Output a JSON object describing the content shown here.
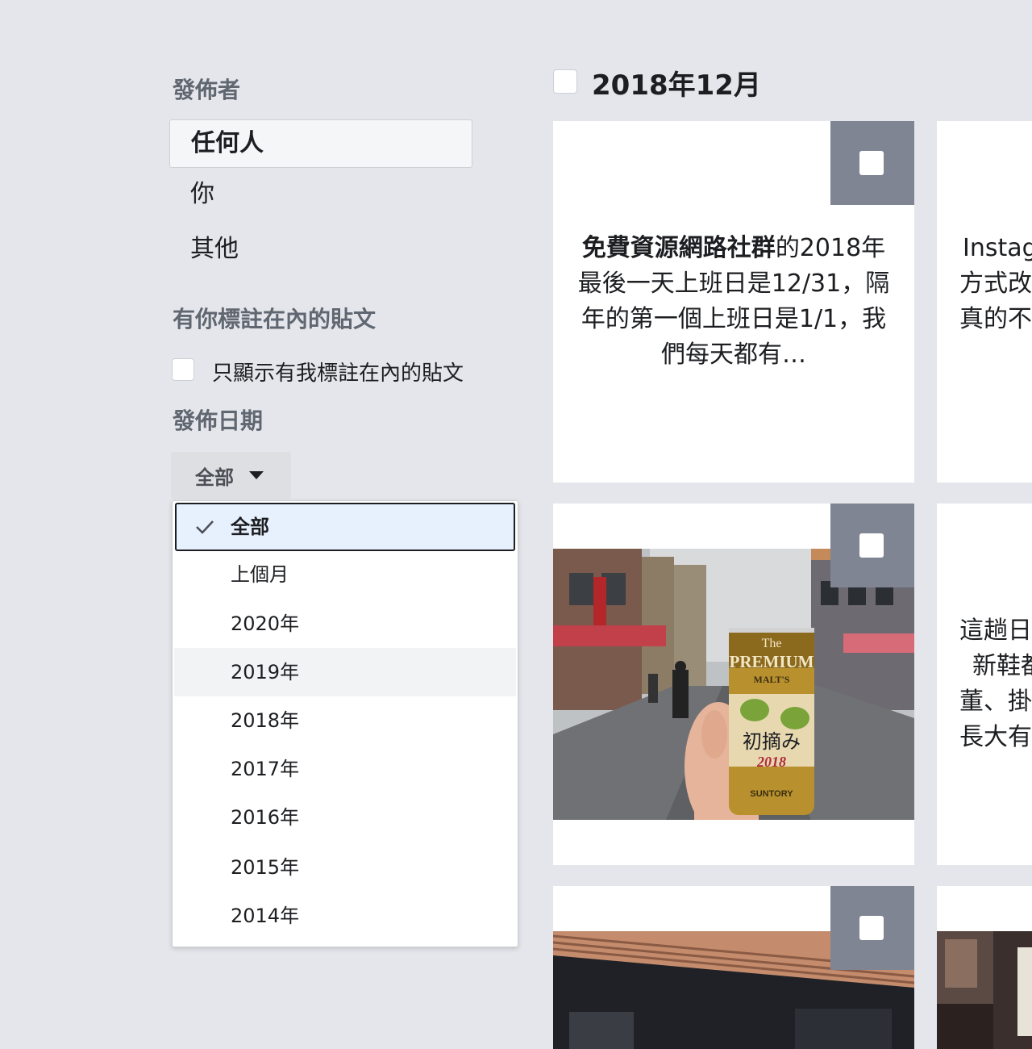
{
  "filters": {
    "publisher": {
      "title": "發佈者",
      "options": [
        "任何人",
        "你",
        "其他"
      ],
      "selected": "任何人"
    },
    "tagged": {
      "title": "有你標註在內的貼文",
      "checkbox_label": "只顯示有我標註在內的貼文",
      "checked": false
    },
    "date": {
      "title": "發佈日期",
      "button_label": "全部",
      "menu_items": [
        "全部",
        "上個月",
        "2020年",
        "2019年",
        "2018年",
        "2017年",
        "2016年",
        "2015年",
        "2014年"
      ],
      "selected": "全部",
      "hovered": "2019年"
    }
  },
  "timeline": {
    "month_label": "2018年12月",
    "posts": [
      {
        "text_bold": "免費資源網路社群",
        "text_rest": "的2018年最後一天上班日是12/31，隔年的第一個上班日是1/1，我們每天都有…"
      },
      {
        "text_lines": [
          "Instag",
          "方式改",
          "真的不"
        ]
      },
      {
        "image": "photo-beer-can-street",
        "image_lettering": [
          "The",
          "PREMIUM",
          "MALT'S",
          "初摘み",
          "2018",
          "SUNTORY"
        ]
      },
      {
        "text_lines": [
          "這趟日",
          "新鞋都",
          "董、掛",
          "長大有"
        ]
      },
      {
        "image": "photo-building-awning"
      },
      {
        "image": "photo-street-signs"
      }
    ]
  },
  "colors": {
    "page_bg": "#e4e6eb",
    "select_overlay": "#7f8593",
    "menu_selected_bg": "#e7f0fd",
    "dropdown_button_bg": "#dddfe2"
  }
}
